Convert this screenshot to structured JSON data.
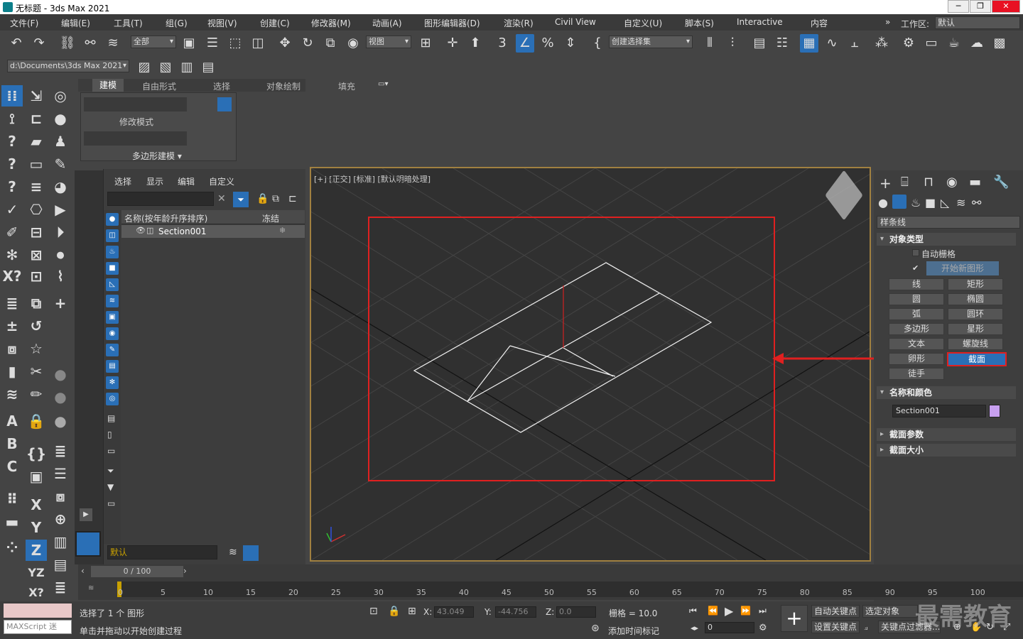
{
  "window": {
    "title": "无标题 - 3ds Max 2021",
    "minimize": "─",
    "maximize": "❐",
    "close": "✕"
  },
  "menu": [
    "文件(F)",
    "编辑(E)",
    "工具(T)",
    "组(G)",
    "视图(V)",
    "创建(C)",
    "修改器(M)",
    "动画(A)",
    "图形编辑器(D)",
    "渲染(R)",
    "Civil View",
    "自定义(U)",
    "脚本(S)",
    "Interactive",
    "内容"
  ],
  "workspace": {
    "label": "工作区:",
    "value": "默认"
  },
  "toolbar": {
    "selection_filter": "全部",
    "ref_coord": "视图",
    "named_selection": "创建选择集",
    "project_path": "d:\\Documents\\3ds Max 2021"
  },
  "ribbon": {
    "tabs": [
      "建模",
      "自由形式",
      "选择",
      "对象绘制",
      "填充"
    ],
    "modify_mode": "修改模式",
    "poly_modeling": "多边形建模 ▾"
  },
  "scene_explorer": {
    "tabs": [
      "选择",
      "显示",
      "编辑",
      "自定义"
    ],
    "col_name": "名称(按年龄升序排序)",
    "col_freeze": "冻结",
    "row_name": "Section001",
    "layer": "默认"
  },
  "viewport": {
    "label": "[+] [正交] [标准] [默认明暗处理]"
  },
  "command_panel": {
    "category": "样条线",
    "object_type_title": "对象类型",
    "auto_grid": "自动栅格",
    "start_new_shape": "开始新图形",
    "buttons": [
      "线",
      "矩形",
      "圆",
      "椭圆",
      "弧",
      "圆环",
      "多边形",
      "星形",
      "文本",
      "螺旋线",
      "卵形",
      "截面",
      "徒手"
    ],
    "active_button": "截面",
    "name_color_title": "名称和颜色",
    "object_name": "Section001",
    "object_color": "#c8a0f0",
    "section_params_title": "截面参数",
    "section_size_title": "截面大小"
  },
  "timeline": {
    "slider": "0 / 100",
    "ticks": [
      "0",
      "5",
      "10",
      "15",
      "20",
      "25",
      "30",
      "35",
      "40",
      "45",
      "50",
      "55",
      "60",
      "65",
      "70",
      "75",
      "80",
      "85",
      "90",
      "95",
      "100"
    ]
  },
  "status": {
    "maxscript": "MAXScript 迷",
    "selected": "选择了 1 个 图形",
    "prompt": "单击并拖动以开始创建过程",
    "x_label": "X:",
    "x": "43.049",
    "y_label": "Y:",
    "y": "-44.756",
    "z_label": "Z:",
    "z": "0.0",
    "grid": "栅格 = 10.0",
    "add_time_tag": "添加时间标记",
    "auto_key": "自动关键点",
    "selected_obj": "选定对象",
    "set_key": "设置关键点",
    "key_filter": "关键点过滤器...",
    "frame": "0",
    "watermark": "最需教育"
  }
}
